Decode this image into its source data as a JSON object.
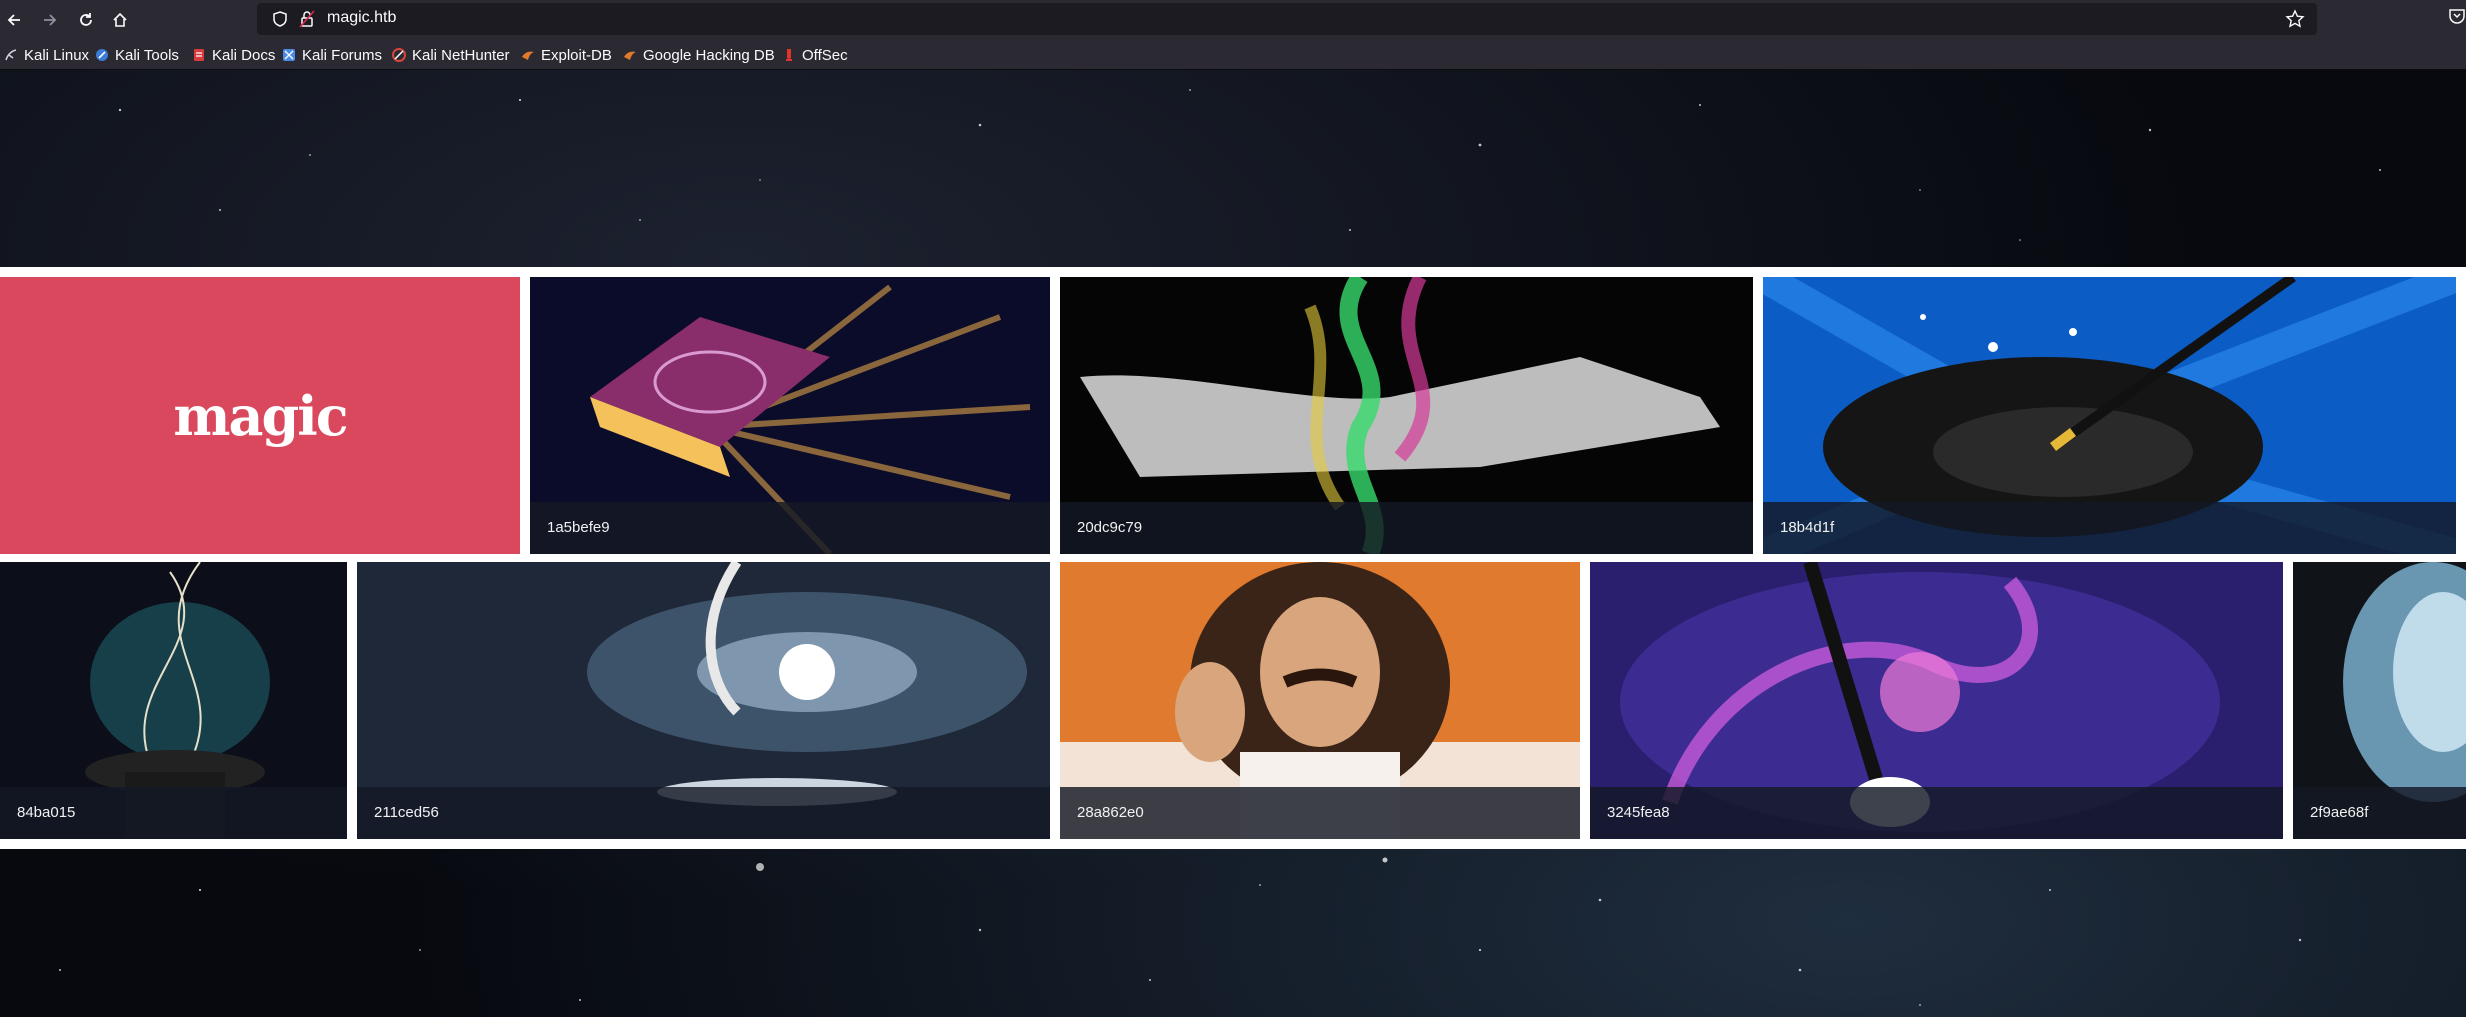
{
  "browser": {
    "url": "magic.htb",
    "bookmarks": [
      {
        "label": "Kali Linux",
        "icon": "kali-dragon-icon",
        "color": "#cfd2db"
      },
      {
        "label": "Kali Tools",
        "icon": "kali-tools-icon",
        "color": "#3d7bd8"
      },
      {
        "label": "Kali Docs",
        "icon": "kali-docs-icon",
        "color": "#d83b3b"
      },
      {
        "label": "Kali Forums",
        "icon": "kali-forums-icon",
        "color": "#4b8be8"
      },
      {
        "label": "Kali NetHunter",
        "icon": "nethunter-icon",
        "color": "#d8453b"
      },
      {
        "label": "Exploit-DB",
        "icon": "exploit-db-icon",
        "color": "#e07a2a"
      },
      {
        "label": "Google Hacking DB",
        "icon": "ghdb-icon",
        "color": "#e07a2a"
      },
      {
        "label": "OffSec",
        "icon": "offsec-icon",
        "color": "#e0342a"
      }
    ]
  },
  "gallery": {
    "logo": {
      "text": "magic",
      "background": "#d9485d"
    },
    "row1": [
      {
        "caption": "1a5befe9",
        "icon": "magic-book-image"
      },
      {
        "caption": "20dc9c79",
        "icon": "magic-hand-smoke-image"
      },
      {
        "caption": "18b4d1f",
        "icon": "top-hat-wand-image"
      }
    ],
    "row2": [
      {
        "caption": "84ba015",
        "icon": "hat-sparkles-image"
      },
      {
        "caption": "211ced56",
        "icon": "galaxy-hand-image"
      },
      {
        "caption": "28a862e0",
        "icon": "magician-man-image"
      },
      {
        "caption": "3245fea8",
        "icon": "wand-sparkles-image"
      },
      {
        "caption": "2f9ae68f",
        "icon": "water-splash-image"
      }
    ]
  }
}
